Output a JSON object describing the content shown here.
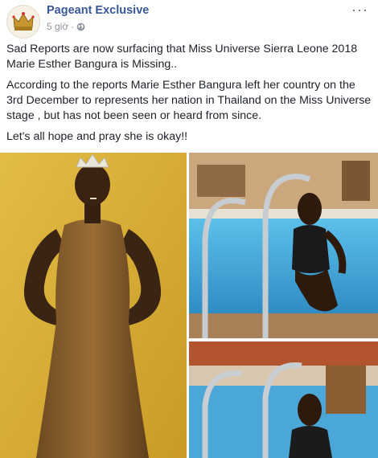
{
  "post": {
    "page_name": "Pageant Exclusive",
    "time": "5 giờ",
    "separator": "·",
    "more_label": "···",
    "privacy_icon": "globe-icon",
    "paragraphs": [
      "Sad Reports are now surfacing that Miss Universe Sierra Leone 2018 Marie Esther Bangura is Missing..",
      "According to the reports Marie Esther Bangura left her country on the 3rd December to represents her nation in Thailand on the Miss Universe stage , but has not been seen or heard from since.",
      "Let's all hope and pray she is okay!!"
    ]
  },
  "colors": {
    "link": "#385898",
    "meta": "#90949c",
    "text": "#1d2129",
    "main_photo_bg": "#d9b23a",
    "pool_water": "#3f9fd3"
  }
}
